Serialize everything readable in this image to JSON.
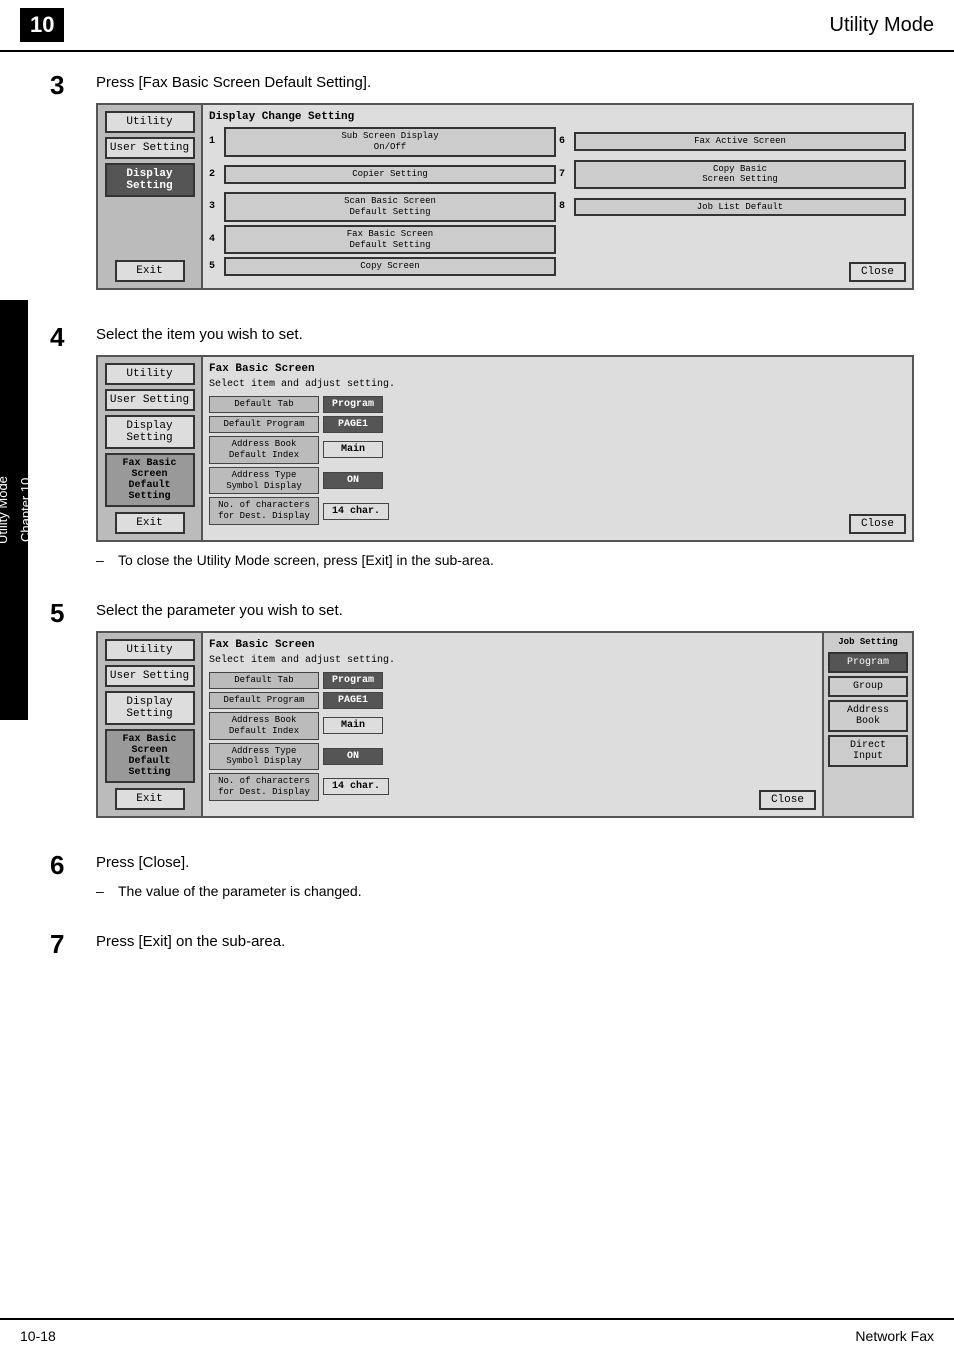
{
  "header": {
    "chapter_num": "10",
    "title": "Utility Mode"
  },
  "footer": {
    "page_num": "10-18",
    "section": "Network Fax"
  },
  "side_tab": {
    "chapter_label": "Chapter 10",
    "mode_label": "Utility Mode"
  },
  "steps": {
    "step3": {
      "number": "3",
      "text": "Press [Fax Basic Screen Default Setting].",
      "screen": {
        "sidebar_buttons": [
          "Utility",
          "User Setting",
          "Display Setting"
        ],
        "exit_btn": "Exit",
        "title": "Display Change Setting",
        "items": [
          {
            "num": "1",
            "label": "Sub Screen Display\nOn/Off"
          },
          {
            "num": "6",
            "label": "Fax Active Screen"
          },
          {
            "num": "2",
            "label": "Copier Setting"
          },
          {
            "num": "7",
            "label": "Copy Basic\nScreen Setting"
          },
          {
            "num": "3",
            "label": "Scan Basic Screen\nDefault Setting"
          },
          {
            "num": "8",
            "label": "Job List Default"
          },
          {
            "num": "4",
            "label": "Fax Basic Screen\nDefault Setting"
          },
          {
            "num": "",
            "label": ""
          },
          {
            "num": "5",
            "label": "Copy Screen"
          },
          {
            "num": "",
            "label": ""
          }
        ],
        "close_btn": "Close"
      }
    },
    "step4": {
      "number": "4",
      "text": "Select the item you wish to set.",
      "screen": {
        "sidebar_buttons": [
          "Utility",
          "User Setting",
          "Display Setting",
          "Fax Basic Screen\nDefault Setting"
        ],
        "exit_btn": "Exit",
        "title": "Fax Basic Screen",
        "subtitle": "Select item and adjust setting.",
        "rows": [
          {
            "label": "Default Tab",
            "value": "Program",
            "value_dark": true
          },
          {
            "label": "Default Program",
            "value": "PAGE1",
            "value_dark": true
          },
          {
            "label": "Address Book\nDefault Index",
            "value": "Main",
            "value_dark": false
          },
          {
            "label": "Address Type\nSymbol Display",
            "value": "ON",
            "value_dark": true
          },
          {
            "label": "No. of characters\nfor Dest. Display",
            "value": "14 char.",
            "value_dark": false
          }
        ],
        "close_btn": "Close"
      },
      "note": "To close the Utility Mode screen, press [Exit] in the sub-area."
    },
    "step5": {
      "number": "5",
      "text": "Select the parameter you wish to set.",
      "screen": {
        "sidebar_buttons": [
          "Utility",
          "User Setting",
          "Display Setting",
          "Fax Basic Screen\nDefault Setting"
        ],
        "exit_btn": "Exit",
        "title": "Fax Basic Screen",
        "subtitle": "Select item and adjust setting.",
        "rows": [
          {
            "label": "Default Tab",
            "value": "Program",
            "value_dark": true
          },
          {
            "label": "Default Program",
            "value": "PAGE1",
            "value_dark": true
          },
          {
            "label": "Address Book\nDefault Index",
            "value": "Main",
            "value_dark": false
          },
          {
            "label": "Address Type\nSymbol Display",
            "value": "ON",
            "value_dark": true
          },
          {
            "label": "No. of characters\nfor Dest. Display",
            "value": "14 char.",
            "value_dark": false
          }
        ],
        "right_panel": {
          "label": "Job Setting",
          "buttons": [
            {
              "label": "Program",
              "dark": true
            },
            {
              "label": "Group",
              "dark": false
            },
            {
              "label": "Address\nBook",
              "dark": false
            },
            {
              "label": "Direct Input",
              "dark": false
            }
          ]
        },
        "close_btn": "Close"
      }
    },
    "step6": {
      "number": "6",
      "text": "Press [Close].",
      "note": "The value of the parameter is changed."
    },
    "step7": {
      "number": "7",
      "text": "Press [Exit] on the sub-area."
    }
  }
}
